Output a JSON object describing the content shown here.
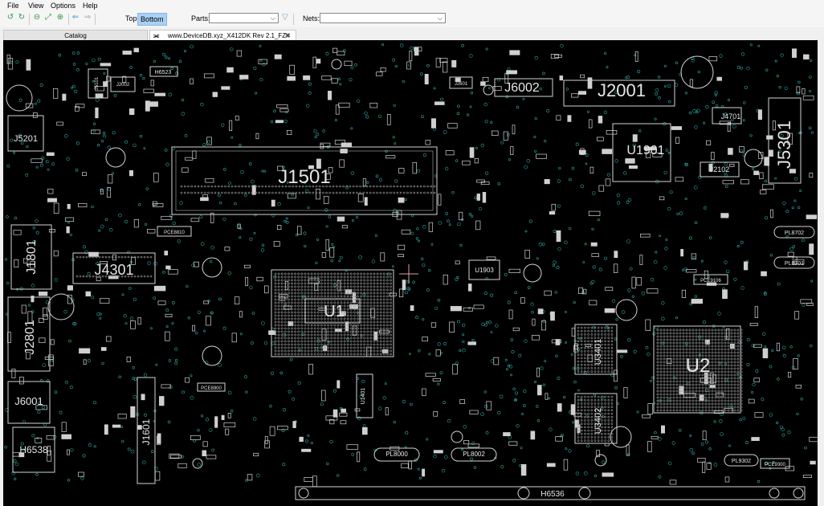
{
  "menu": {
    "file": "File",
    "view": "View",
    "options": "Options",
    "help": "Help"
  },
  "toolbar": {
    "top": "Top",
    "bottom": "Bottom",
    "parts_label": "Parts:",
    "parts_value": "",
    "nets_label": "Nets:",
    "nets_value": ""
  },
  "tabs": {
    "catalog": "Catalog",
    "document": "www.DeviceDB.xyz_X412DK Rev 2.1_FZ"
  },
  "board": {
    "labels": [
      "J1501",
      "U1",
      "U2",
      "J2001",
      "J6002",
      "J5301",
      "U1901",
      "J5201",
      "J4301",
      "J1801",
      "J2801",
      "J6001",
      "H6538",
      "J1601",
      "U3401",
      "U3402",
      "H6536",
      "J4701",
      "J2102",
      "H6523",
      "U1903",
      "PL8000",
      "PL8002",
      "PL8702",
      "PL8701",
      "PL9302",
      "PCE9300",
      "PCE9106",
      "J2601",
      "J2002",
      "J5101",
      "PCE8810",
      "PCE8900",
      "U1401"
    ],
    "colors": {
      "outline": "#d4d4d4",
      "via": "#2aa8a0",
      "text": "#e6e6e6",
      "background": "#000000"
    }
  }
}
